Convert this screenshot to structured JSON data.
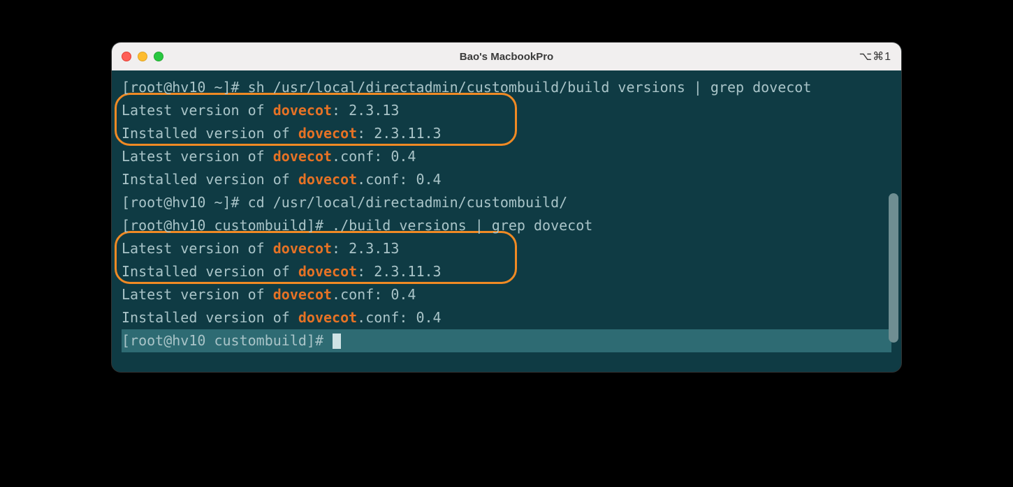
{
  "window": {
    "title": "Bao's MacbookPro",
    "shortcut": "⌥⌘1"
  },
  "colors": {
    "background": "#0f3b44",
    "text": "#a9c4c8",
    "highlight": "#e67225",
    "prompt_bg": "#2e6b73",
    "callout_border": "#f08a24"
  },
  "terminal": {
    "lines": [
      {
        "kind": "cmd",
        "pre": "[root@hv10 ~]# sh /usr/local/directadmin/custombuild/build versions | grep dovecot"
      },
      {
        "kind": "out",
        "pre": "Latest version of ",
        "hl": "dovecot",
        "post": ": 2.3.13"
      },
      {
        "kind": "out",
        "pre": "Installed version of ",
        "hl": "dovecot",
        "post": ": 2.3.11.3"
      },
      {
        "kind": "out",
        "pre": "Latest version of ",
        "hl": "dovecot",
        "post": ".conf: 0.4"
      },
      {
        "kind": "out",
        "pre": "Installed version of ",
        "hl": "dovecot",
        "post": ".conf: 0.4"
      },
      {
        "kind": "cmd",
        "pre": "[root@hv10 ~]# cd /usr/local/directadmin/custombuild/"
      },
      {
        "kind": "cmd",
        "pre": "[root@hv10 custombuild]# ./build versions | grep dovecot"
      },
      {
        "kind": "out",
        "pre": "Latest version of ",
        "hl": "dovecot",
        "post": ": 2.3.13"
      },
      {
        "kind": "out",
        "pre": "Installed version of ",
        "hl": "dovecot",
        "post": ": 2.3.11.3"
      },
      {
        "kind": "out",
        "pre": "Latest version of ",
        "hl": "dovecot",
        "post": ".conf: 0.4"
      },
      {
        "kind": "out",
        "pre": "Installed version of ",
        "hl": "dovecot",
        "post": ".conf: 0.4"
      }
    ],
    "active_prompt": "[root@hv10 custombuild]# "
  }
}
